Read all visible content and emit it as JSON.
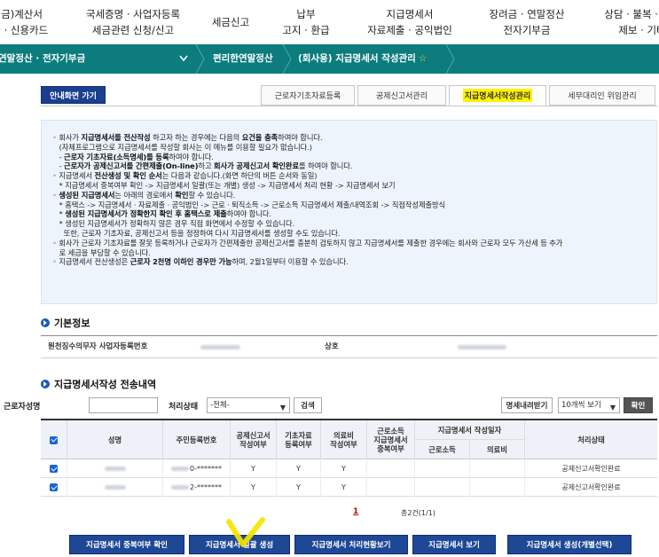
{
  "topnav": [
    {
      "l1": "(세금)계산서",
      "l2": "발급 · 신용카드"
    },
    {
      "l1": "국세증명 · 사업자등록",
      "l2": "세금관련 신청/신고"
    },
    {
      "l1": "세금신고",
      "l2": ""
    },
    {
      "l1": "납부",
      "l2": "고지 · 환급"
    },
    {
      "l1": "지급명세서",
      "l2": "자료제출 · 공익법인"
    },
    {
      "l1": "장려금 · 연말정산",
      "l2": "전자기부금"
    },
    {
      "l1": "상담 · 불복 · 고충",
      "l2": "제보 · 기타"
    }
  ],
  "breadcrumb": {
    "section": "연말정산 · 전자기부금",
    "page": "편리한연말정산",
    "current": "(회사용) 지급명세서 작성관리",
    "star": "☆"
  },
  "guide_button": "안내화면 가기",
  "tabs": [
    {
      "label": "근로자기초자료등록",
      "active": false
    },
    {
      "label": "공제신고서관리",
      "active": false
    },
    {
      "label": "지급명세서작성관리",
      "active": true
    },
    {
      "label": "세무대리인 위임관리",
      "active": false
    }
  ],
  "notice": {
    "lines": [
      {
        "html": "◦ 회사가 <b>지급명세서를 전산작성</b> 하고자 하는 경우에는 다음의 <b>요건을 충족</b>하여야 합니다."
      },
      {
        "html": "&nbsp;&nbsp;&nbsp;(자체프로그램으로 지급명세서를 작성할 회사는 이 메뉴를 이용할 필요가 없습니다.)"
      },
      {
        "html": "&nbsp;&nbsp;&nbsp;- <b>근로자 기초자료(소득명세)를 등록</b>하여야 합니다."
      },
      {
        "html": "&nbsp;&nbsp;&nbsp;- <b>근로자가 공제신고서를 간편제출(On-line)</b>하고 <b>회사가 공제신고서 확인완료</b>를 하여야 합니다."
      },
      {
        "html": "◦ 지급명세서 <b>전산생성 및 확인 순서</b>는 다음과 같습니다.(화면 하단의 버튼 순서와 동일)"
      },
      {
        "html": "&nbsp;&nbsp;&nbsp;* 지급명세서 중복여부 확인 -&gt; 지급명세서 일괄(또는 개별) 생성 -&gt; 지급명세서 처리 현황 -&gt; 지급명세서 보기"
      },
      {
        "html": "◦ <b>생성된 지급명세서</b>는 아래의 경로에서 <b>확인</b>할 수 있습니다."
      },
      {
        "html": "&nbsp;&nbsp;&nbsp;* 홈택스 -&gt; 지급명세서 · 자료제출 · 공익법인 -&gt; 근로 · 퇴직소득 -&gt; 근로소득 지급명세서 제출/내역조회 -&gt; 직접작성제출방식"
      },
      {
        "html": "&nbsp;&nbsp;&nbsp;* <b>생성된 지급명세서가 정확한지 확인 후 홈택스로 제출</b>하여야 합니다."
      },
      {
        "html": "&nbsp;&nbsp;&nbsp;* 생성된 지급명세서가 정확하지 않은 경우 직접 화면에서 수정할 수 있습니다."
      },
      {
        "html": "&nbsp;&nbsp;&nbsp;&nbsp;&nbsp;또한, 근로자 기초자료, 공제신고서 등을 정정하여 다시 지급명세서를 생성할 수도 있습니다."
      },
      {
        "html": "◦ 회사가 근로자 기초자료를 잘못 등록하거나 근로자가 간편제출한 공제신고서를 충분히 검토하지 않고 지급명세서를 제출한 경우에는 회사와 근로자 모두 가산세 등 추가"
      },
      {
        "html": "&nbsp;&nbsp;&nbsp;로 세금을 부담할 수 있습니다."
      },
      {
        "html": "◦ 지급명세서 전산생성은 <b>근로자 2천명 이하인 경우만 가능</b>하며, 2월1일부터 이용할 수 있습니다."
      }
    ]
  },
  "basic_info": {
    "title": "기본정보",
    "business_no_label": "원천징수의무자 사업자등록번호",
    "company_label": "상호"
  },
  "list": {
    "title": "지급명세서작성 전송내역",
    "search": {
      "name_label": "근로자성명",
      "status_label": "처리상태",
      "status_value": "-전체-",
      "search_button": "검색",
      "download_button": "명세내려받기",
      "page_size": "10개씩 보기",
      "confirm_button": "확인"
    },
    "headers": {
      "name": "성명",
      "rrn": "주민등록번호",
      "deduction_submitted": "공제신고서\n작성여부",
      "base_registered": "기초자료\n등록여부",
      "medical_submitted": "의료비\n작성여부",
      "duplicate": "근로소득\n지급명세서\n중복여부",
      "created_date": "지급명세서 작성일자",
      "earned": "근로소득",
      "medical": "의료비",
      "status": "처리상태"
    },
    "rows": [
      {
        "rrn": "0-*******",
        "deduction": "Y",
        "base": "Y",
        "medical": "Y",
        "status": "공제신고서확인완료"
      },
      {
        "rrn": "2-*******",
        "deduction": "Y",
        "base": "Y",
        "medical": "Y",
        "status": "공제신고서확인완료"
      }
    ],
    "pager": "1",
    "total": "총2건(1/1)"
  },
  "actions": [
    "지급명세서 중복여부 확인",
    "지급명세서 일괄 생성",
    "지급명세서 처리현황보기",
    "지급명세서 보기",
    "지급명세서 생성(개별선택)"
  ],
  "colors": {
    "brand_green": "#0c7c7d",
    "navy_button": "#1e4796",
    "highlight": "#fff200",
    "notice_bg": "#eef4fb"
  }
}
